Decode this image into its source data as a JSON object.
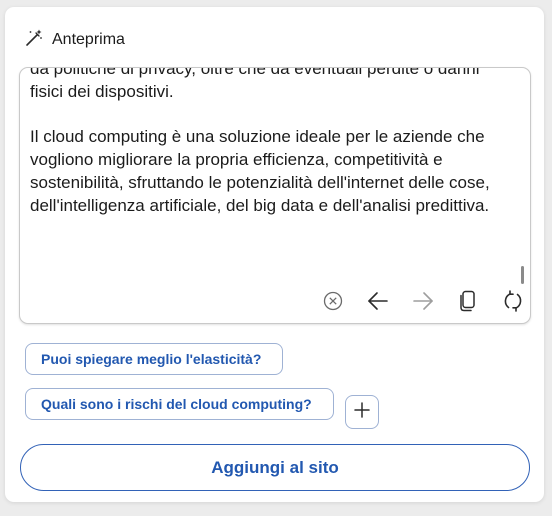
{
  "header": {
    "title": "Anteprima",
    "icon": "magic-wand-icon"
  },
  "preview": {
    "paragraph_1": "da politiche di privacy, oltre che da eventuali perdite o danni fisici dei dispositivi.",
    "paragraph_2": "Il cloud computing è una soluzione ideale per le aziende che vogliono migliorare la propria efficienza, competitività e sostenibilità, sfruttando le potenzialità dell'internet delle cose, dell'intelligenza artificiale, del big data e dell'analisi predittiva."
  },
  "toolbar": {
    "icons": [
      "stop-icon",
      "back-arrow-icon",
      "forward-arrow-icon",
      "copy-icon",
      "regenerate-icon"
    ]
  },
  "suggestions": {
    "chip_1": "Puoi spiegare meglio l'elasticità?",
    "chip_2": "Quali sono i rischi del cloud computing?"
  },
  "add_button": {
    "label": "Aggiungi al sito"
  },
  "colors": {
    "accent": "#2258b0",
    "chip_border": "#9fb2d4",
    "button_border": "#3262b7",
    "panel_bg": "#ffffff",
    "page_bg": "#ececec"
  }
}
